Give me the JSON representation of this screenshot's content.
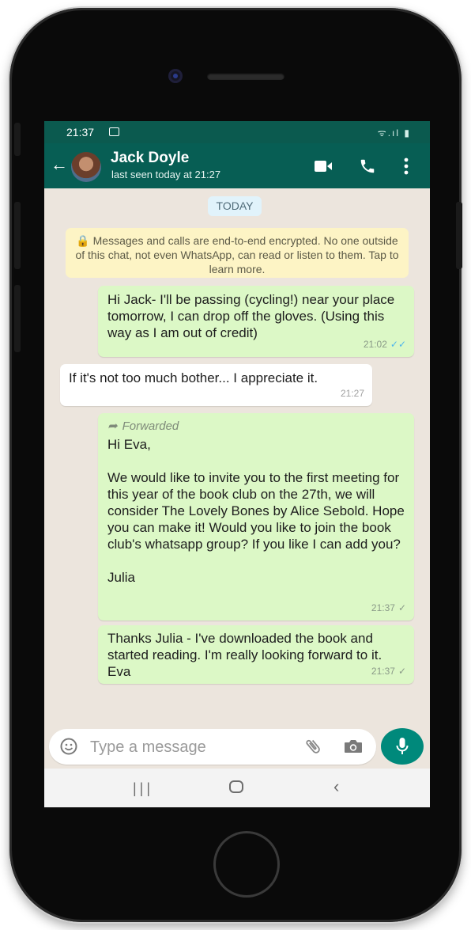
{
  "status_bar": {
    "time": "21:37",
    "signal_text": "ᯤ.ıl ▮"
  },
  "header": {
    "contact_name": "Jack Doyle",
    "last_seen": "last seen today at 21:27"
  },
  "chat": {
    "date_chip": "TODAY",
    "encryption_notice": "🔒 Messages and calls are end-to-end encrypted. No one outside of this chat, not even WhatsApp, can read or listen to them. Tap to learn more.",
    "messages": [
      {
        "direction": "outgoing",
        "text": "Hi Jack- I'll be passing (cycling!) near your place tomorrow, I can drop off the gloves. (Using this way as I am out of credit)",
        "time": "21:02",
        "status": "read"
      },
      {
        "direction": "incoming",
        "text": "If it's not too much bother... I appreciate it.",
        "time": "21:27"
      },
      {
        "direction": "outgoing",
        "forwarded_label": "Forwarded",
        "text": "Hi Eva,\n\nWe would like to invite you to the first meeting for this year of the book club on the 27th, we will consider The Lovely Bones by Alice Sebold. Hope you can make it! Would you like to join the book club's whatsapp group? If you like I can add you?\n\nJulia",
        "time": "21:37",
        "status": "sent"
      },
      {
        "direction": "outgoing",
        "text": "Thanks Julia - I've downloaded the book and started reading. I'm really looking forward to it. Eva",
        "time": "21:37",
        "status": "sent"
      }
    ]
  },
  "composer": {
    "placeholder": "Type a message"
  },
  "colors": {
    "header": "#075e54",
    "outgoing_bubble": "#dcf8c6",
    "incoming_bubble": "#ffffff",
    "mic_button": "#00897b",
    "read_tick": "#4fb6ec"
  },
  "icons": [
    "back-arrow-icon",
    "video-call-icon",
    "voice-call-icon",
    "more-options-icon",
    "emoji-icon",
    "attach-icon",
    "camera-icon",
    "mic-icon"
  ]
}
